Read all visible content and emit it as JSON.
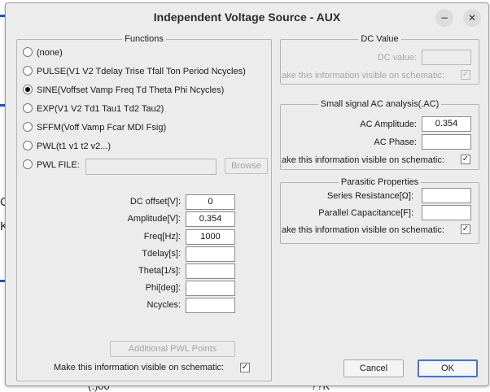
{
  "title": "Independent Voltage Source - AUX",
  "window_buttons": {
    "minimize": "−",
    "close": "✕"
  },
  "background": {
    "text_1": "C",
    "text_2": "K",
    "text_3": "(.)00",
    "text_4": "??K"
  },
  "functions": {
    "legend": "Functions",
    "options": [
      {
        "label": "(none)",
        "selected": false
      },
      {
        "label": "PULSE(V1 V2 Tdelay Trise Tfall Ton Period Ncycles)",
        "selected": false
      },
      {
        "label": "SINE(Voffset Vamp Freq Td Theta Phi Ncycles)",
        "selected": true
      },
      {
        "label": "EXP(V1 V2 Td1 Tau1 Td2 Tau2)",
        "selected": false
      },
      {
        "label": "SFFM(Voff Vamp Fcar MDI Fsig)",
        "selected": false
      },
      {
        "label": "PWL(t1 v1 t2 v2...)",
        "selected": false
      },
      {
        "label": "PWL FILE:",
        "selected": false
      }
    ],
    "pwl_file_value": "",
    "browse_label": "Browse",
    "params": [
      {
        "label": "DC offset[V]:",
        "value": "0"
      },
      {
        "label": "Amplitude[V]:",
        "value": "0.354"
      },
      {
        "label": "Freq[Hz]:",
        "value": "1000"
      },
      {
        "label": "Tdelay[s]:",
        "value": ""
      },
      {
        "label": "Theta[1/s]:",
        "value": ""
      },
      {
        "label": "Phi[deg]:",
        "value": ""
      },
      {
        "label": "Ncycles:",
        "value": ""
      }
    ],
    "additional_pwl_label": "Additional PWL Points",
    "visible_label": "Make this information visible on schematic:",
    "visible_checked": true
  },
  "dc_value": {
    "legend": "DC Value",
    "label": "DC value:",
    "value": "",
    "visible_label": "ake this information visible on schematic:",
    "visible_checked": true
  },
  "ac_analysis": {
    "legend": "Small signal AC analysis(.AC)",
    "amplitude_label": "AC Amplitude:",
    "amplitude_value": "0.354",
    "phase_label": "AC Phase:",
    "phase_value": "",
    "visible_label": "ake this information visible on schematic:",
    "visible_checked": true
  },
  "parasitic": {
    "legend": "Parasitic Properties",
    "series_label": "Series Resistance[Ω]:",
    "series_value": "",
    "parallel_label": "Parallel Capacitance[F]:",
    "parallel_value": "",
    "visible_label": "ake this information visible on schematic:",
    "visible_checked": true
  },
  "buttons": {
    "cancel": "Cancel",
    "ok": "OK"
  },
  "check_glyph": "✓"
}
